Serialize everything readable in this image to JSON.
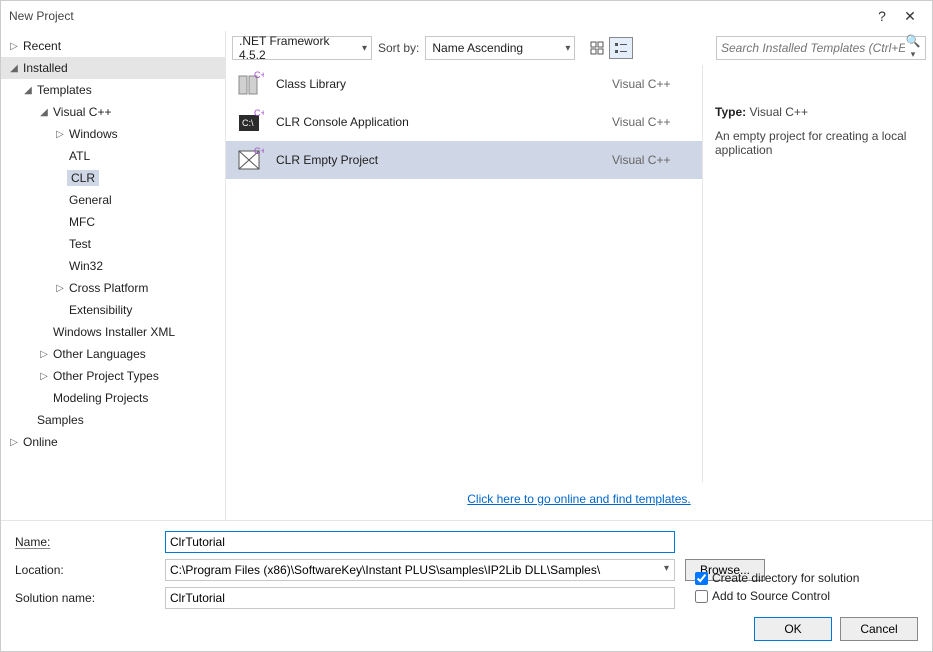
{
  "title": "New Project",
  "sidebar": {
    "recent": "Recent",
    "installed": "Installed",
    "templates": "Templates",
    "vcpp": "Visual C++",
    "vcpp_children": [
      "Windows",
      "ATL",
      "CLR",
      "General",
      "MFC",
      "Test",
      "Win32"
    ],
    "cross_platform": "Cross Platform",
    "extensibility": "Extensibility",
    "wix": "Windows Installer XML",
    "other_lang": "Other Languages",
    "other_proj": "Other Project Types",
    "modeling": "Modeling Projects",
    "samples": "Samples",
    "online": "Online"
  },
  "toolbar": {
    "framework": ".NET Framework 4.5.2",
    "sort_label": "Sort by:",
    "sort_value": "Name Ascending",
    "search_placeholder": "Search Installed Templates (Ctrl+E)"
  },
  "templates": [
    {
      "name": "Class Library",
      "lang": "Visual C++"
    },
    {
      "name": "CLR Console Application",
      "lang": "Visual C++"
    },
    {
      "name": "CLR Empty Project",
      "lang": "Visual C++"
    }
  ],
  "selected_template_index": 2,
  "online_link": "Click here to go online and find templates.",
  "details": {
    "type_label": "Type:",
    "type_value": "Visual C++",
    "desc": "An empty project for creating a local application"
  },
  "form": {
    "name_label": "Name:",
    "name_value": "ClrTutorial",
    "loc_label": "Location:",
    "loc_value": "C:\\Program Files (x86)\\SoftwareKey\\Instant PLUS\\samples\\IP2Lib DLL\\Samples\\",
    "sol_label": "Solution name:",
    "sol_value": "ClrTutorial",
    "browse": "Browse...",
    "create_dir": "Create directory for solution",
    "add_scm": "Add to Source Control",
    "ok": "OK",
    "cancel": "Cancel"
  }
}
